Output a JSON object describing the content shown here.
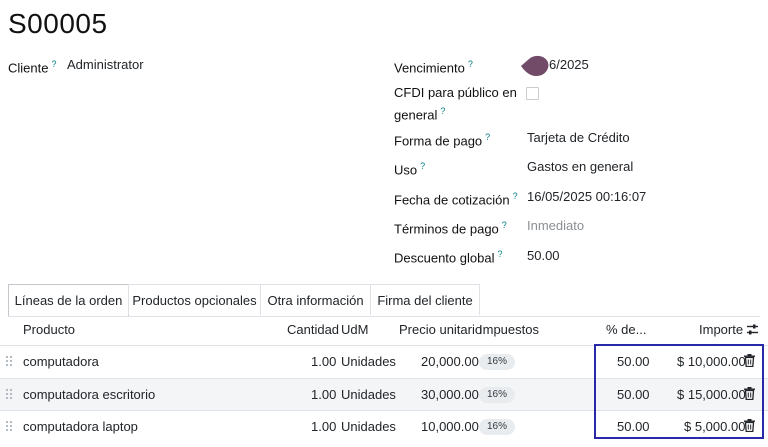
{
  "record": {
    "title": "S00005"
  },
  "left_fields": {
    "cliente_label": "Cliente",
    "cliente_value": "Administrator"
  },
  "right_fields": {
    "vencimiento_label": "Vencimiento",
    "vencimiento_value": "6/2025",
    "cfdi_label_1": "CFDI para público en",
    "cfdi_label_2": "general",
    "forma_pago_label": "Forma de pago",
    "forma_pago_value": "Tarjeta de Crédito",
    "uso_label": "Uso",
    "uso_value": "Gastos en general",
    "fecha_label": "Fecha de cotización",
    "fecha_value": "16/05/2025 00:16:07",
    "terminos_label": "Términos de pago",
    "terminos_value": "Inmediato",
    "descuento_label": "Descuento global",
    "descuento_value": "50.00"
  },
  "help_mark": "?",
  "tabs": [
    {
      "label": "Líneas de la orden"
    },
    {
      "label": "Productos opcionales"
    },
    {
      "label": "Otra información"
    },
    {
      "label": "Firma del cliente"
    }
  ],
  "table": {
    "headers": {
      "producto": "Producto",
      "cantidad": "Cantidad",
      "udm": "UdM",
      "precio": "Precio unitario",
      "impuestos": "Impuestos",
      "descuento": "% de...",
      "importe": "Importe"
    },
    "rows": [
      {
        "producto": "computadora",
        "cantidad": "1.00",
        "udm": "Unidades",
        "precio": "20,000.00",
        "impuesto": "16%",
        "descuento": "50.00",
        "importe": "$ 10,000.00"
      },
      {
        "producto": "computadora escritorio",
        "cantidad": "1.00",
        "udm": "Unidades",
        "precio": "30,000.00",
        "impuesto": "16%",
        "descuento": "50.00",
        "importe": "$ 15,000.00"
      },
      {
        "producto": "computadora laptop",
        "cantidad": "1.00",
        "udm": "Unidades",
        "precio": "10,000.00",
        "impuesto": "16%",
        "descuento": "50.00",
        "importe": "$ 5,000.00"
      }
    ]
  },
  "colors": {
    "accent": "#017e84",
    "highlight_border": "#2828a8",
    "avatar": "#714b67"
  },
  "icons": {
    "drag": "drag-handle-icon",
    "delete": "trash-icon",
    "column_settings": "sliders-icon"
  }
}
